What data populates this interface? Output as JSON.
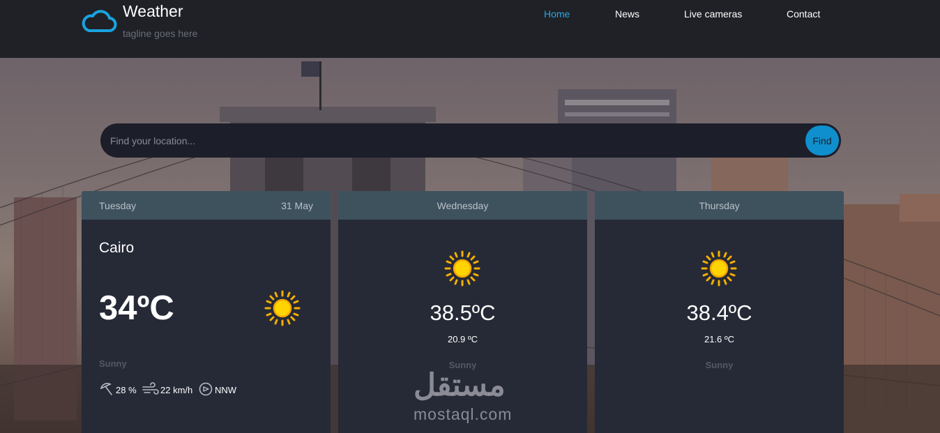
{
  "header": {
    "title": "Weather",
    "tagline": "tagline goes here",
    "logo_icon": "cloud-icon",
    "nav": [
      {
        "label": "Home",
        "active": true
      },
      {
        "label": "News",
        "active": false
      },
      {
        "label": "Live cameras",
        "active": false
      },
      {
        "label": "Contact",
        "active": false
      }
    ]
  },
  "search": {
    "placeholder": "Find your location...",
    "button_label": "Find"
  },
  "today": {
    "day": "Tuesday",
    "date": "31 May",
    "city": "Cairo",
    "temp": "34ºC",
    "icon": "sun-icon",
    "condition": "Sunny",
    "humidity": "28 %",
    "wind_speed": "22 km/h",
    "wind_direction": "NNW"
  },
  "forecast": [
    {
      "day": "Wednesday",
      "max": "38.5ºC",
      "min": "20.9 ºC",
      "condition": "Sunny",
      "icon": "sun-icon"
    },
    {
      "day": "Thursday",
      "max": "38.4ºC",
      "min": "21.6 ºC",
      "condition": "Sunny",
      "icon": "sun-icon"
    }
  ],
  "watermark": {
    "arabic": "مستقل",
    "latin": "mostaql.com"
  },
  "colors": {
    "accent": "#0f8fce",
    "header_bg": "#1f2126",
    "card_bg": "#262936",
    "card_head_bg": "#3e525e"
  }
}
